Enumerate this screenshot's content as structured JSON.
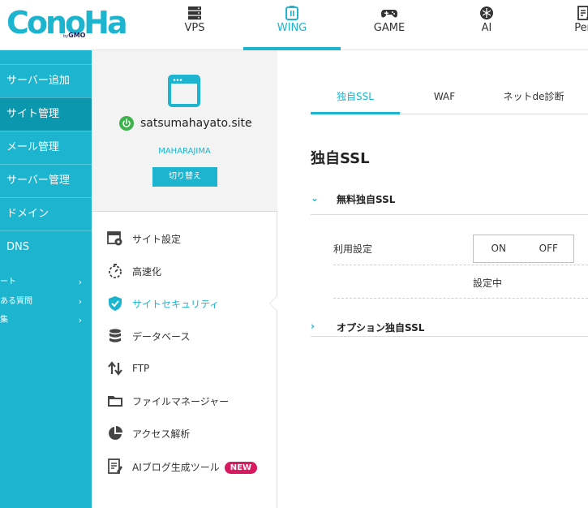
{
  "brand": {
    "logo_text": "ConoHa",
    "logo_sub_by": "by",
    "logo_sub_gmo": "GMO",
    "accent": "#1cb4cf"
  },
  "topnav": {
    "items": [
      {
        "label": "VPS",
        "icon": "server-icon"
      },
      {
        "label": "WING",
        "icon": "wing-building-icon",
        "active": true
      },
      {
        "label": "GAME",
        "icon": "gamepad-icon"
      },
      {
        "label": "AI",
        "icon": "ai-icon"
      },
      {
        "label": "Pen",
        "icon": "pen-doc-icon"
      }
    ]
  },
  "sidebar": {
    "items": [
      {
        "label": "サーバー追加"
      },
      {
        "label": "サイト管理",
        "active": true
      },
      {
        "label": "メール管理"
      },
      {
        "label": "サーバー管理"
      },
      {
        "label": "ドメイン"
      },
      {
        "label": "DNS"
      }
    ],
    "subitems": [
      {
        "label": "ート"
      },
      {
        "label": "ある質問"
      },
      {
        "label": "集"
      }
    ]
  },
  "site": {
    "name": "satsumahayato.site",
    "server": "MAHARAJIMA",
    "switch_label": "切り替え"
  },
  "site_menu": [
    {
      "label": "サイト設定",
      "icon": "site-settings-icon"
    },
    {
      "label": "高速化",
      "icon": "stopwatch-icon"
    },
    {
      "label": "サイトセキュリティ",
      "icon": "shield-check-icon",
      "active": true
    },
    {
      "label": "データベース",
      "icon": "database-icon"
    },
    {
      "label": "FTP",
      "icon": "transfer-arrows-icon"
    },
    {
      "label": "ファイルマネージャー",
      "icon": "folder-icon"
    },
    {
      "label": "アクセス解析",
      "icon": "pie-chart-icon"
    },
    {
      "label": "AIブログ生成ツール",
      "icon": "ai-blog-icon",
      "badge": "NEW"
    }
  ],
  "tabs": [
    {
      "label": "独自SSL",
      "active": true
    },
    {
      "label": "WAF"
    },
    {
      "label": "ネットde診断"
    }
  ],
  "content": {
    "title": "独自SSL",
    "free_ssl": {
      "label": "無料独自SSL",
      "setting_label": "利用設定",
      "on_label": "ON",
      "off_label": "OFF",
      "status": "設定中"
    },
    "option_ssl": {
      "label": "オプション独自SSL"
    }
  }
}
